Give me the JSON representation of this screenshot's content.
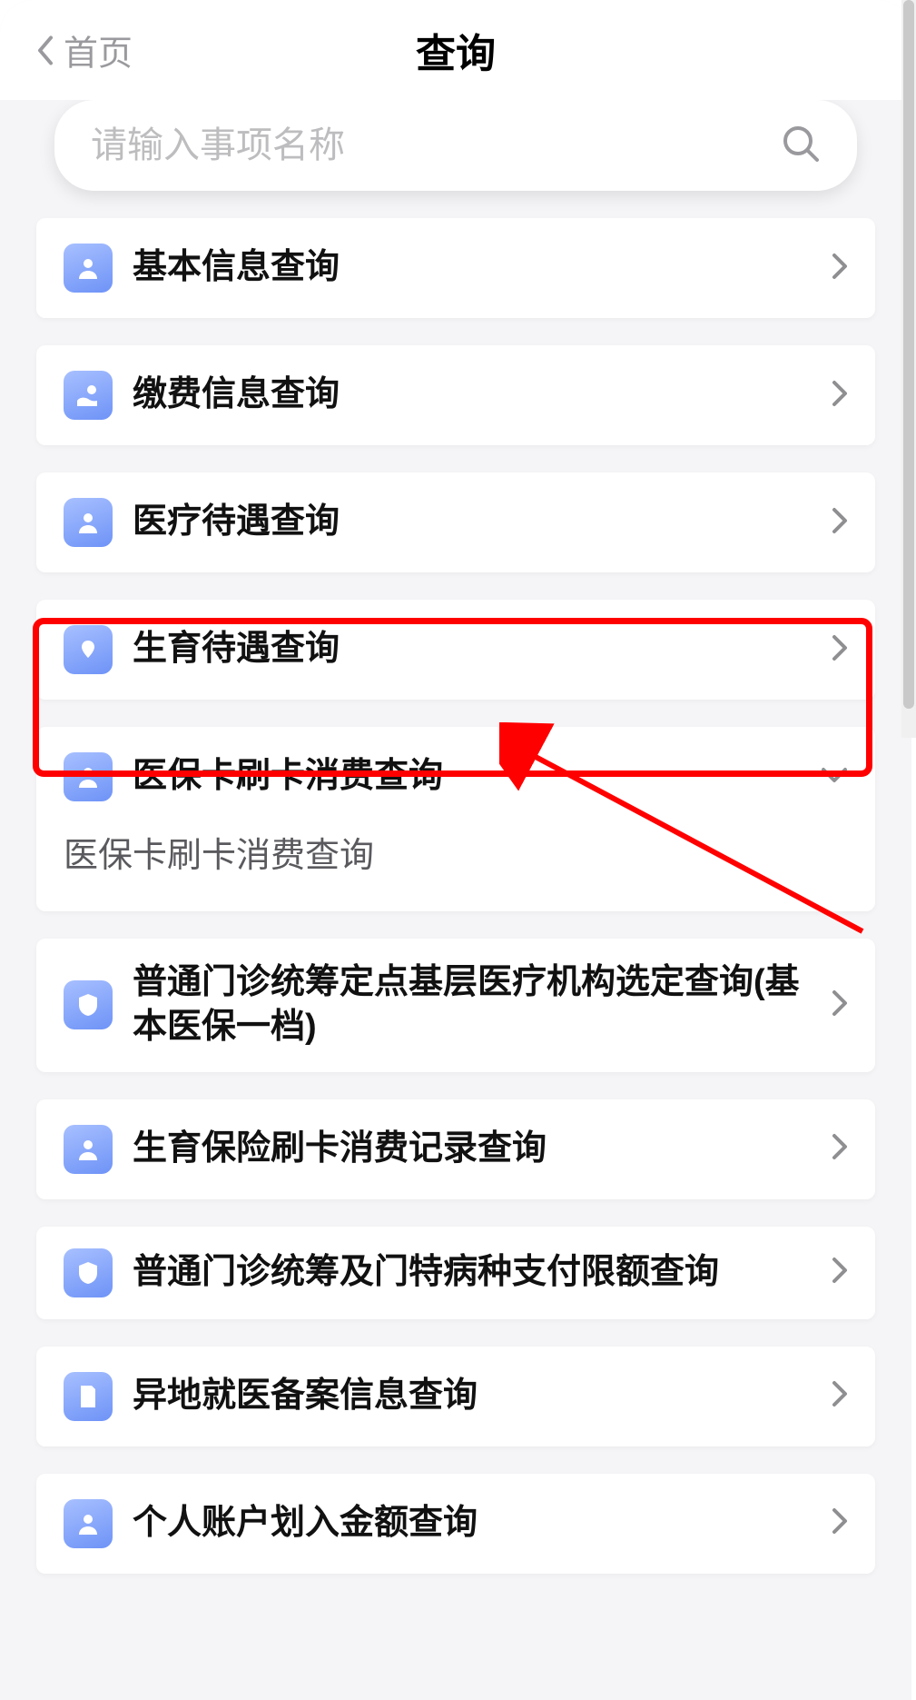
{
  "header": {
    "back_label": "首页",
    "title": "查询"
  },
  "search": {
    "placeholder": "请输入事项名称"
  },
  "items": [
    {
      "label": "基本信息查询",
      "icon": "person",
      "expanded": false
    },
    {
      "label": "缴费信息查询",
      "icon": "hand",
      "expanded": false
    },
    {
      "label": "医疗待遇查询",
      "icon": "person",
      "expanded": false
    },
    {
      "label": "生育待遇查询",
      "icon": "hands",
      "expanded": false
    },
    {
      "label": "医保卡刷卡消费查询",
      "icon": "person",
      "expanded": true,
      "sub": "医保卡刷卡消费查询"
    },
    {
      "label": "普通门诊统筹定点基层医疗机构选定查询(基本医保一档)",
      "icon": "shield",
      "expanded": false
    },
    {
      "label": "生育保险刷卡消费记录查询",
      "icon": "person",
      "expanded": false
    },
    {
      "label": "普通门诊统筹及门特病种支付限额查询",
      "icon": "shield",
      "expanded": false
    },
    {
      "label": "异地就医备案信息查询",
      "icon": "doc",
      "expanded": false
    },
    {
      "label": "个人账户划入金额查询",
      "icon": "person",
      "expanded": false
    }
  ],
  "annotation": {
    "highlight_item_index": 4
  }
}
